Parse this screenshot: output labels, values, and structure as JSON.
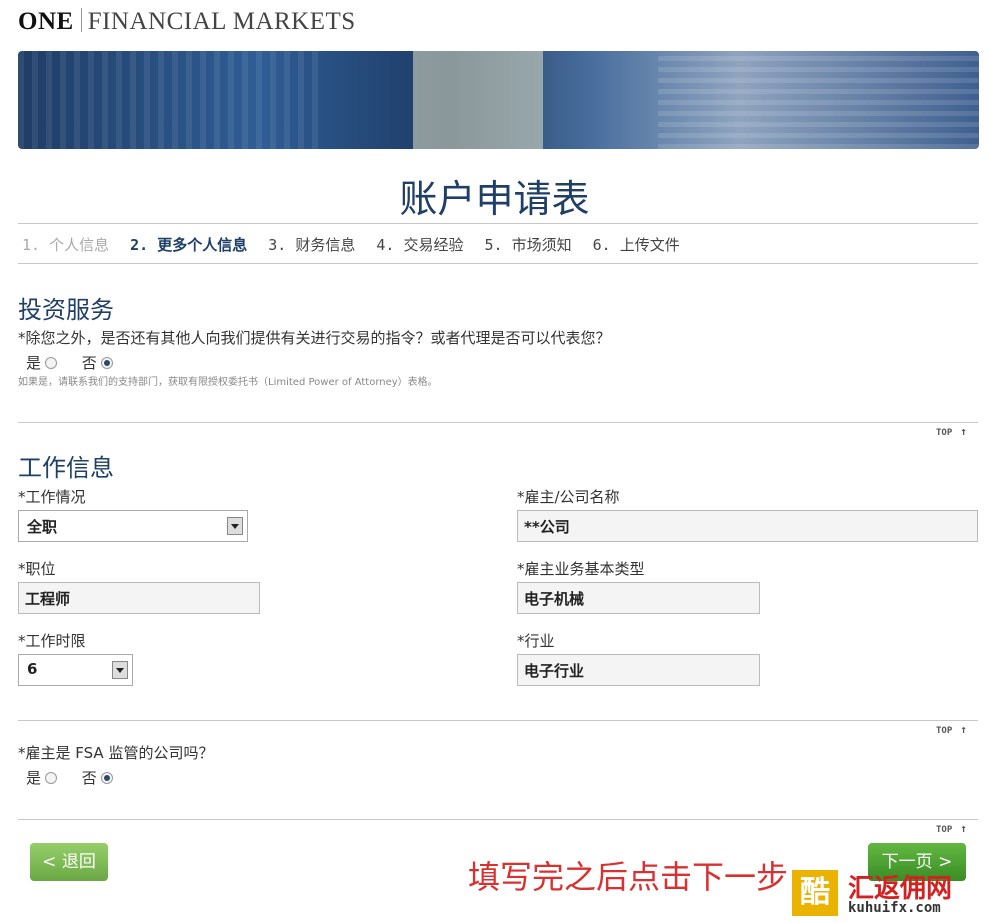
{
  "header": {
    "logo_one": "ONE",
    "logo_rest": "FINANCIAL MARKETS"
  },
  "page_title": "账户申请表",
  "steps": [
    {
      "label": "1. 个人信息",
      "state": "done"
    },
    {
      "label": "2. 更多个人信息",
      "state": "active"
    },
    {
      "label": "3. 财务信息",
      "state": "todo"
    },
    {
      "label": "4. 交易经验",
      "state": "todo"
    },
    {
      "label": "5. 市场须知",
      "state": "todo"
    },
    {
      "label": "6. 上传文件",
      "state": "todo"
    }
  ],
  "investment": {
    "title": "投资服务",
    "question": "*除您之外，是否还有其他人向我们提供有关进行交易的指令？或者代理是否可以代表您？",
    "yes": "是",
    "no": "否",
    "selected": "no",
    "note": "如果是，请联系我们的支持部门，获取有限授权委托书（Limited Power of Attorney）表格。"
  },
  "top_label": "TOP",
  "top_arrow": "↑",
  "work": {
    "title": "工作信息",
    "status_label": "*工作情况",
    "status_value": "全职",
    "employer_label": "*雇主/公司名称",
    "employer_value": "**公司",
    "position_label": "*职位",
    "position_value": "工程师",
    "business_type_label": "*雇主业务基本类型",
    "business_type_value": "电子机械",
    "duration_label": "*工作时限",
    "duration_value": "6",
    "industry_label": "*行业",
    "industry_value": "电子行业"
  },
  "fsa": {
    "question": "*雇主是 FSA 监管的公司吗？",
    "yes": "是",
    "no": "否",
    "selected": "no"
  },
  "buttons": {
    "back": "< 退回",
    "next": "下一页 >"
  },
  "annotation": "填写完之后点击下一步",
  "watermark": {
    "glyph": "酷",
    "cn": "汇返佣网",
    "en": "kuhuifx.com"
  },
  "colors": {
    "heading": "#1f3f66",
    "button_green": "#6aa845",
    "annotation_red": "#d93030"
  }
}
